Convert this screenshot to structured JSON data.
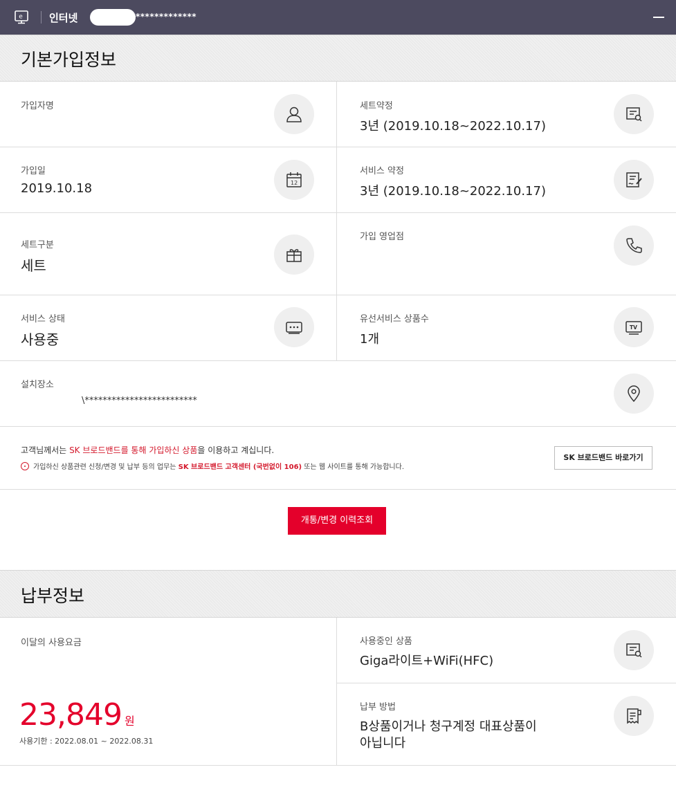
{
  "header": {
    "service": "인터넷",
    "account_masked": "*************",
    "tv_icon": "monitor-e-icon",
    "menu_icon": "minus-icon"
  },
  "basic_info": {
    "title": "기본가입정보",
    "subscriber_name": {
      "label": "가입자명",
      "value": "",
      "icon": "person-icon"
    },
    "set_contract": {
      "label": "세트약정",
      "value": "3년 (2019.10.18~2022.10.17)",
      "icon": "document-search-icon"
    },
    "join_date": {
      "label": "가입일",
      "value": "2019.10.18",
      "icon": "calendar-icon"
    },
    "service_contract": {
      "label": "서비스 약정",
      "value": "3년 (2019.10.18~2022.10.17)",
      "icon": "document-sign-icon"
    },
    "set_type": {
      "label": "세트구분",
      "value": "세트",
      "icon": "gift-icon"
    },
    "join_store": {
      "label": "가입 영업점",
      "value": "",
      "icon": "phone-icon"
    },
    "service_status": {
      "label": "서비스 상태",
      "value": "사용중",
      "icon": "modem-icon"
    },
    "wired_count": {
      "label": "유선서비스 상품수",
      "value": "1개",
      "icon": "tv-icon"
    },
    "install_location": {
      "label": "설치장소",
      "value": "\\*************************",
      "icon": "location-pin-icon"
    }
  },
  "notice": {
    "line1_pre": "고객님께서는 ",
    "line1_red": "SK 브로드밴드를 통해 가입하신 상품",
    "line1_post": "을 이용하고 계십니다.",
    "line2_pre": "가입하신 상품관련 신청/변경 및 납부 등의 업무는 ",
    "line2_red": "SK 브로드밴드 고객센터 (국번없이 106)",
    "line2_post": " 또는 웹 사이트를 통해 가능합니다.",
    "sk_link_label": "SK 브로드밴드 바로가기"
  },
  "history_button": "개통/변경 이력조회",
  "payment_info": {
    "title": "납부정보",
    "monthly_fee_label": "이달의 사용요금",
    "monthly_fee_amount": "23,849",
    "monthly_fee_unit": "원",
    "usage_period": "사용기한 : 2022.08.01 ~ 2022.08.31",
    "product": {
      "label": "사용중인 상품",
      "value": "Giga라이트+WiFi(HFC)",
      "icon": "document-search-icon"
    },
    "payment_method": {
      "label": "납부 방법",
      "value_line1": "B상품이거나 청구계정 대표상품이",
      "value_line2": "아닙니다",
      "icon": "receipt-icon"
    }
  },
  "colors": {
    "accent_red": "#e4002b",
    "header_bg": "#4c4a5f"
  }
}
